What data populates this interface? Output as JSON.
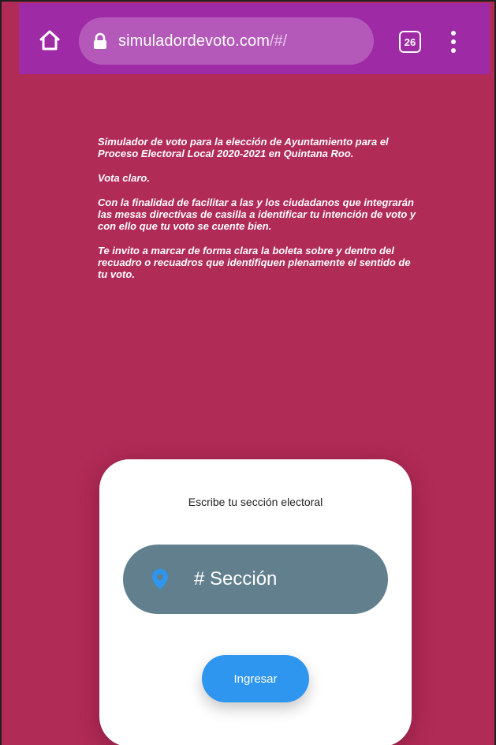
{
  "browser": {
    "url_domain": "simuladordevoto.com",
    "url_path": "/#/",
    "tab_count": "26",
    "toolbar_color": "#9f2aa6"
  },
  "intro": {
    "paragraphs": [
      "Simulador de voto para la elección de Ayuntamiento para el Proceso Electoral Local 2020-2021 en Quintana Roo.",
      "Vota claro.",
      "Con la finalidad de facilitar a las y los ciudadanos que integrarán las mesas directivas de casilla a identificar tu intención de voto y con ello que tu voto se cuente bien.",
      "Te invito a marcar de forma clara la boleta sobre y dentro del recuadro o recuadros que identifiquen plenamente el sentido de tu voto."
    ]
  },
  "form": {
    "title": "Escribe tu sección electoral",
    "section_placeholder": "# Sección",
    "section_value": "",
    "submit_label": "Ingresar"
  },
  "colors": {
    "background": "#b12b57",
    "field": "#617f8d",
    "button": "#2f96ef",
    "pin_icon": "#2f96ef"
  },
  "icons": {
    "home": "home-icon",
    "lock": "lock-icon",
    "tabs": "tabs-icon",
    "menu": "more-vert-icon",
    "pin": "location-pin-icon"
  }
}
